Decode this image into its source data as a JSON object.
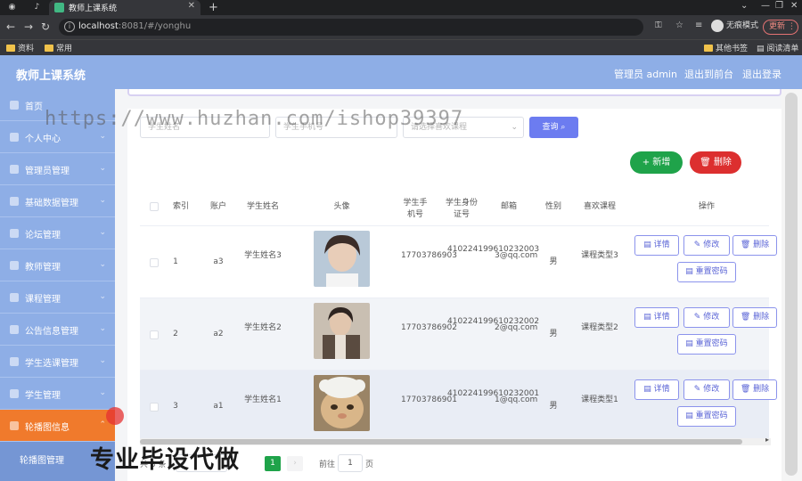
{
  "browser": {
    "tab_title": "教师上课系统",
    "url_host": "localhost",
    "url_rest": ":8081/#/yonghu",
    "incognito_label": "无痕模式",
    "update_label": "更新",
    "bookmarks": [
      "资料",
      "常用"
    ],
    "bookmarks_right": [
      "其他书签",
      "阅读清单"
    ]
  },
  "header": {
    "brand": "教师上课系统",
    "user": "管理员 admin",
    "back_front": "退出到前台",
    "logout": "退出登录"
  },
  "sidebar": {
    "items": [
      {
        "label": "首页"
      },
      {
        "label": "个人中心"
      },
      {
        "label": "管理员管理"
      },
      {
        "label": "基础数据管理"
      },
      {
        "label": "论坛管理"
      },
      {
        "label": "教师管理"
      },
      {
        "label": "课程管理"
      },
      {
        "label": "公告信息管理"
      },
      {
        "label": "学生选课管理"
      },
      {
        "label": "学生管理"
      },
      {
        "label": "轮播图信息"
      }
    ],
    "submenu_label": "轮播图管理"
  },
  "search": {
    "field1_placeholder": "学生姓名",
    "field2_placeholder": "学生手机号",
    "field3_placeholder": "请选择喜欢课程",
    "query_label": "查询 ⌕"
  },
  "actions": {
    "add_label": "+ 新增",
    "delete_label": "🗑 删除"
  },
  "table": {
    "headers": [
      "索引",
      "账户",
      "学生姓名",
      "头像",
      "学生手机号",
      "学生身份证号",
      "邮箱",
      "性别",
      "喜欢课程",
      "操作"
    ],
    "rows": [
      {
        "index": "1",
        "account": "a3",
        "name": "学生姓名3",
        "phone": "17703786903",
        "idcard": "410224199610232003",
        "email": "3@qq.com",
        "gender": "男",
        "course": "课程类型3"
      },
      {
        "index": "2",
        "account": "a2",
        "name": "学生姓名2",
        "phone": "17703786902",
        "idcard": "410224199610232002",
        "email": "2@qq.com",
        "gender": "男",
        "course": "课程类型2"
      },
      {
        "index": "3",
        "account": "a1",
        "name": "学生姓名1",
        "phone": "17703786901",
        "idcard": "410224199610232001",
        "email": "1@qq.com",
        "gender": "男",
        "course": "课程类型1"
      }
    ],
    "op_labels": {
      "detail": "详情",
      "edit": "修改",
      "delete": "删除",
      "reset": "重置密码"
    }
  },
  "pager": {
    "total": "共 3 条",
    "page": "1",
    "goto": "前往",
    "goto_value": "1",
    "page_word": "页"
  },
  "overlay": {
    "watermark": "https://www.huzhan.com/ishop39397",
    "promo": "专业毕设代做"
  },
  "colors": {
    "header": "#8eaee6",
    "active": "#f07a2c",
    "primary": "#6c7cf0",
    "success": "#1fa34a",
    "danger": "#dc2f2f"
  }
}
